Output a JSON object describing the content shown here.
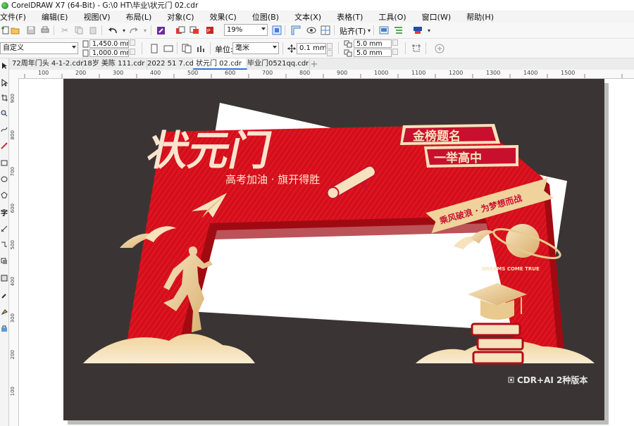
{
  "window": {
    "title": "CorelDRAW X7 (64-Bit) - G:\\0 HT\\毕业\\状元门 02.cdr"
  },
  "menu": [
    "文件(F)",
    "编辑(E)",
    "视图(V)",
    "布局(L)",
    "对象(C)",
    "效果(C)",
    "位图(B)",
    "文本(X)",
    "表格(T)",
    "工具(O)",
    "窗口(W)",
    "帮助(H)"
  ],
  "toolbar": {
    "zoom": "19%",
    "snap_label": "贴齐(T)"
  },
  "property_bar": {
    "page_preset": "自定义",
    "width": "1,450.0 mm",
    "height": "1,000.0 mm",
    "units_label": "单位:",
    "units_value": "毫米",
    "nudge": "0.1 mm",
    "dup_x": "5.0 mm",
    "dup_y": "5.0 mm"
  },
  "tabs": [
    {
      "label": "72周年门头 4-1-2.cdr",
      "active": false
    },
    {
      "label": "18岁 美陈 111.cdr",
      "active": false
    },
    {
      "label": "2022 51 7.cdr",
      "active": false
    },
    {
      "label": "状元门 02.cdr",
      "active": true
    },
    {
      "label": "毕业门0521qq.cdr",
      "active": false
    }
  ],
  "ruler": {
    "h_ticks": [
      "100",
      "200",
      "300",
      "400",
      "500",
      "600",
      "700",
      "800",
      "900",
      "1000",
      "1100",
      "1200",
      "1300",
      "1400",
      "1500"
    ],
    "v_ticks": [
      "900",
      "800",
      "700",
      "600",
      "500",
      "400",
      "300",
      "200",
      "100"
    ]
  },
  "artwork": {
    "title": "状元门",
    "subtitle": "高考加油 · 旗开得胜",
    "badge_top": "金榜题名",
    "badge_bottom": "一举高中",
    "ribbon": "乘风破浪 · 为梦想而战",
    "dreams": "DREAMS COME TRUE",
    "version_note": "CDR+AI 2种版本"
  },
  "colors": {
    "bg": "#3a3534",
    "red": "#d80f1c",
    "dark_red": "#a50b14",
    "gold": "#e9c98d",
    "cream": "#f6e2bd"
  }
}
